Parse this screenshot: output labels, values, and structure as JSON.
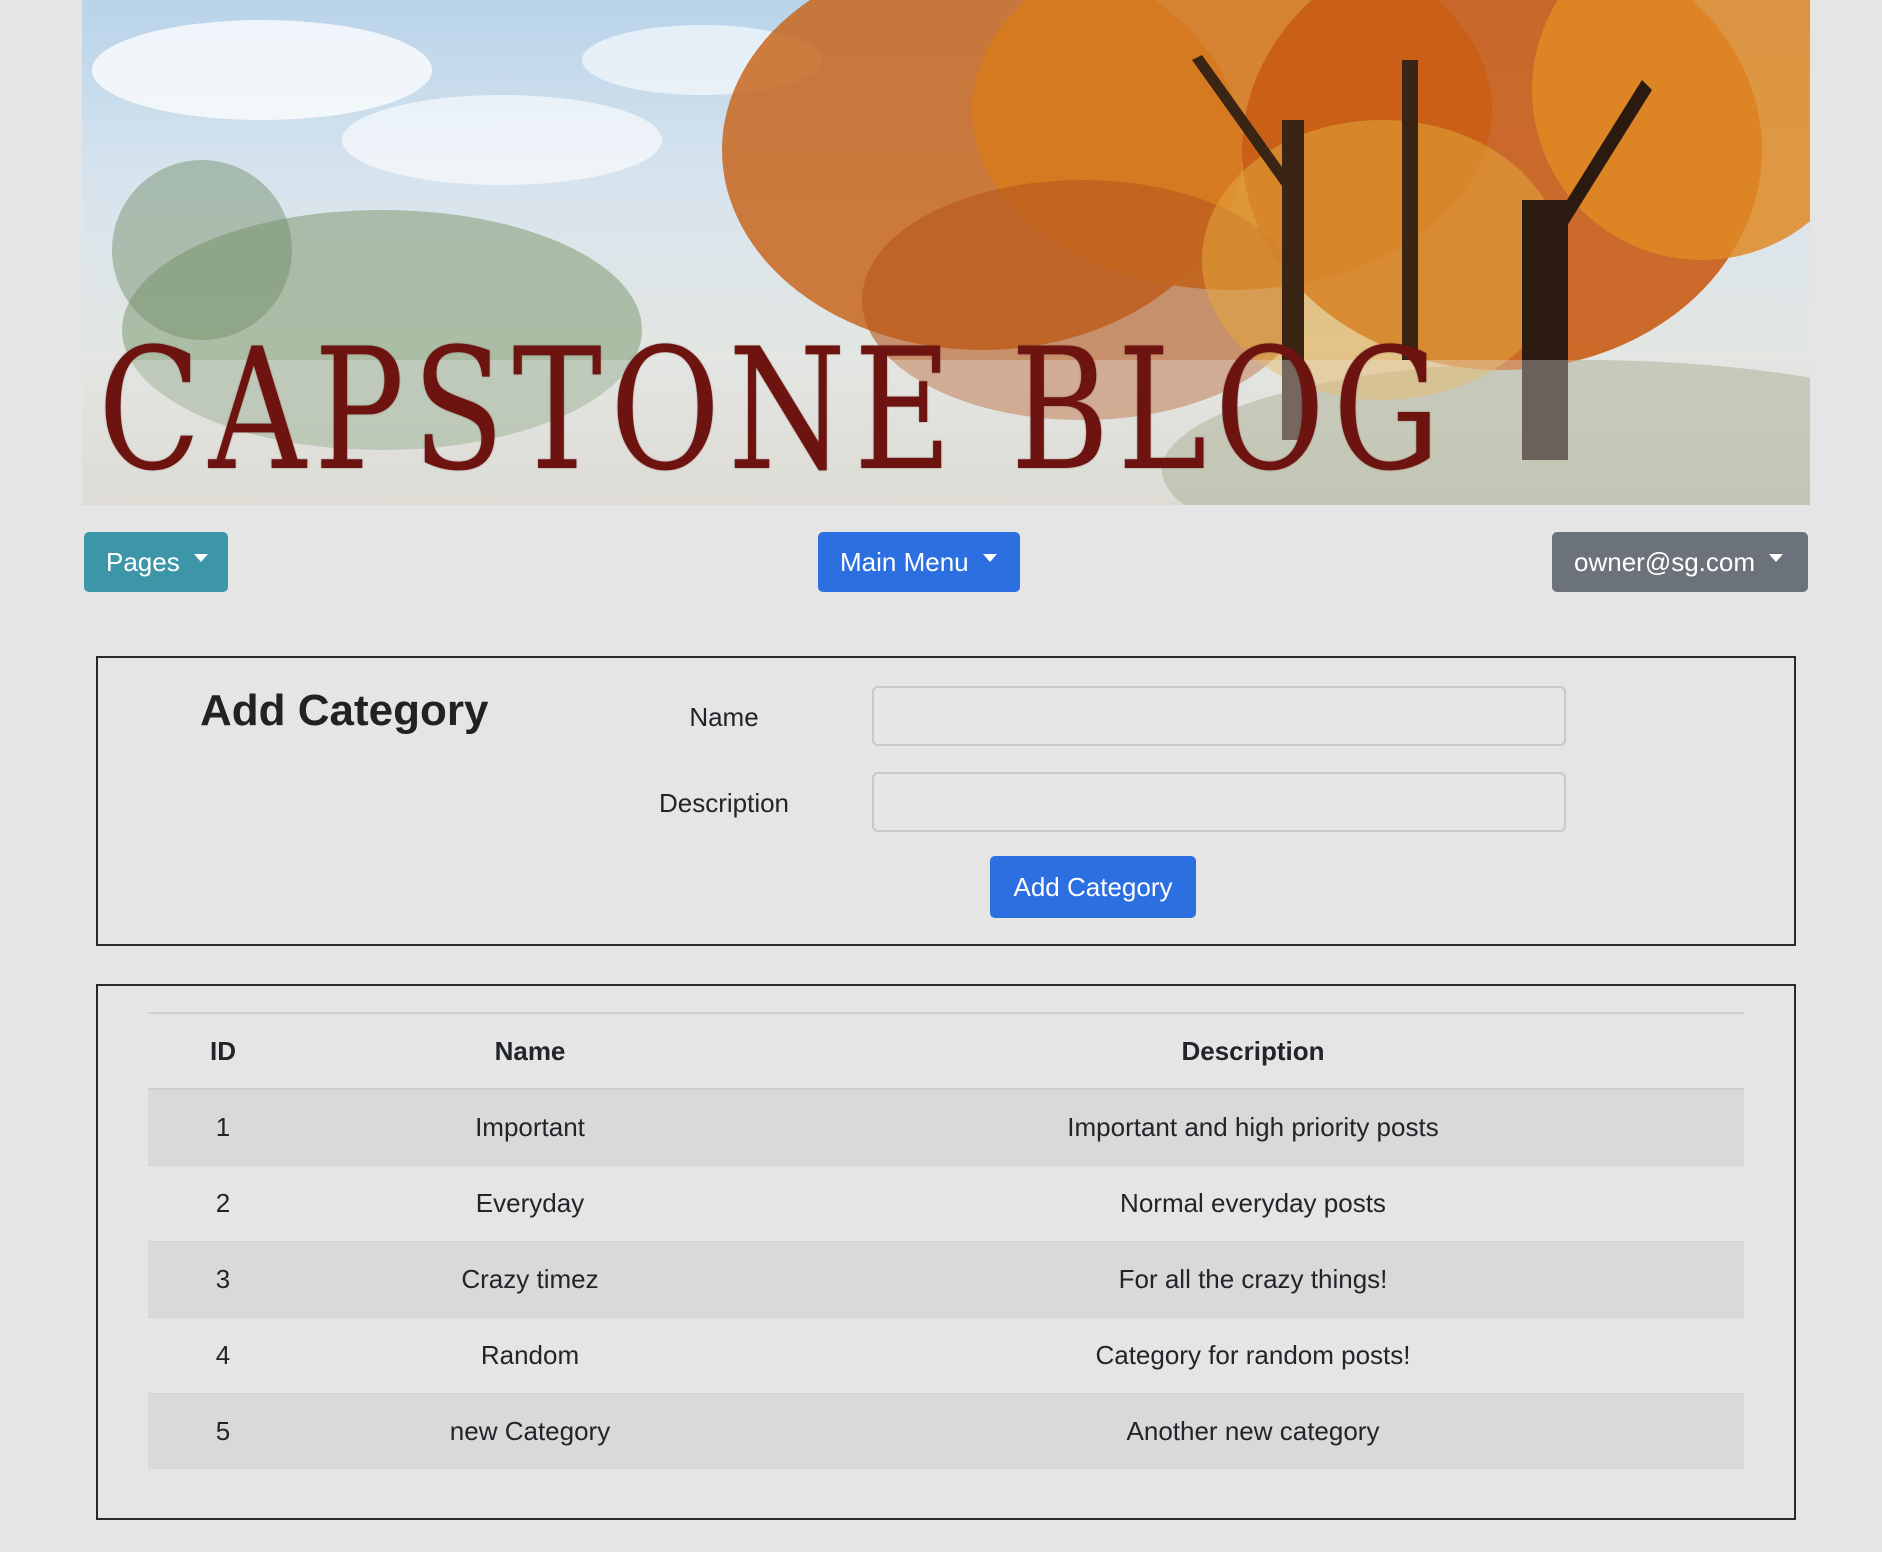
{
  "banner": {
    "title": "CAPSTONE BLOG"
  },
  "nav": {
    "pages_label": "Pages",
    "main_menu_label": "Main Menu",
    "user_label": "owner@sg.com"
  },
  "add_form": {
    "heading": "Add Category",
    "name_label": "Name",
    "name_value": "",
    "description_label": "Description",
    "description_value": "",
    "submit_label": "Add Category"
  },
  "table": {
    "headers": [
      "ID",
      "Name",
      "Description"
    ],
    "rows": [
      [
        "1",
        "Important",
        "Important and high priority posts"
      ],
      [
        "2",
        "Everyday",
        "Normal everyday posts"
      ],
      [
        "3",
        "Crazy timez",
        "For all the crazy things!"
      ],
      [
        "4",
        "Random",
        "Category for random posts!"
      ],
      [
        "5",
        "new Category",
        "Another new category"
      ]
    ]
  },
  "colors": {
    "background": "#e5e5e5",
    "pages_button": "#3d96a8",
    "primary_button": "#2b6fe0",
    "user_button": "#6c727a",
    "banner_title": "#6e1410"
  }
}
